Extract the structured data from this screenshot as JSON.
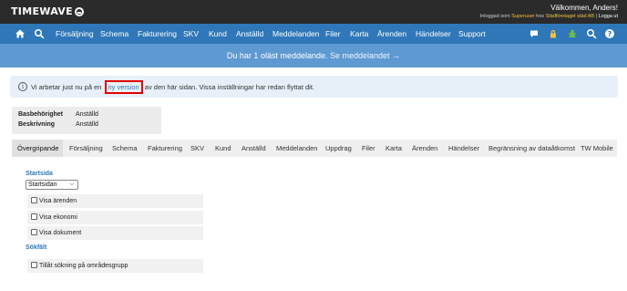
{
  "header": {
    "logo_text": "TIMEWAVE",
    "welcome": "Välkommen, Anders!",
    "logged_in_prefix": "Inloggad som",
    "user": "Superuser",
    "at": "hos",
    "company": "Städföretaget städ AB",
    "separator": "|",
    "logout": "Logga ut"
  },
  "nav": {
    "items": [
      "Försäljning",
      "Schema",
      "Fakturering",
      "SKV",
      "Kund",
      "Anställd",
      "Meddelanden",
      "Filer",
      "Karta",
      "Ärenden",
      "Händelser",
      "Support"
    ],
    "icons": [
      "home-icon",
      "search-icon",
      "chat-icon",
      "lock-icon",
      "bug-icon",
      "search-icon",
      "help-icon"
    ]
  },
  "banner": {
    "text": "Du har 1 oläst meddelande.",
    "link": "Se meddelandet →"
  },
  "info": {
    "icon": "i",
    "before": "Vi arbetar just nu på en",
    "link": "ny version",
    "after": "av den här sidan. Vissa inställningar har redan flyttat dit."
  },
  "permissions": {
    "rows": [
      {
        "label": "Basbehörighet",
        "value": "Anställd"
      },
      {
        "label": "Beskrivning",
        "value": "Anställd"
      }
    ]
  },
  "tabs": [
    "Övergripande",
    "Försäljning",
    "Schema",
    "Fakturering",
    "SKV",
    "Kund",
    "Anställd",
    "Meddelanden",
    "Uppdrag",
    "Filer",
    "Karta",
    "Ärenden",
    "Händelser",
    "Begränsning av dataåtkomst",
    "TW Mobile"
  ],
  "active_tab": "Övergripande",
  "startsida": {
    "title": "Startsida",
    "selected": "Startsidan",
    "checkboxes": [
      "Visa ärenden",
      "Visa ekonomi",
      "Visa dokument"
    ]
  },
  "sokfalt": {
    "title": "Sökfält",
    "checkboxes": [
      "Tillåt sökning på områdesgrupp"
    ]
  },
  "colors": {
    "topbar": "#2b2b2b",
    "nav": "#2f77b8",
    "banner": "#5e99d2",
    "highlight": "#e00000"
  }
}
